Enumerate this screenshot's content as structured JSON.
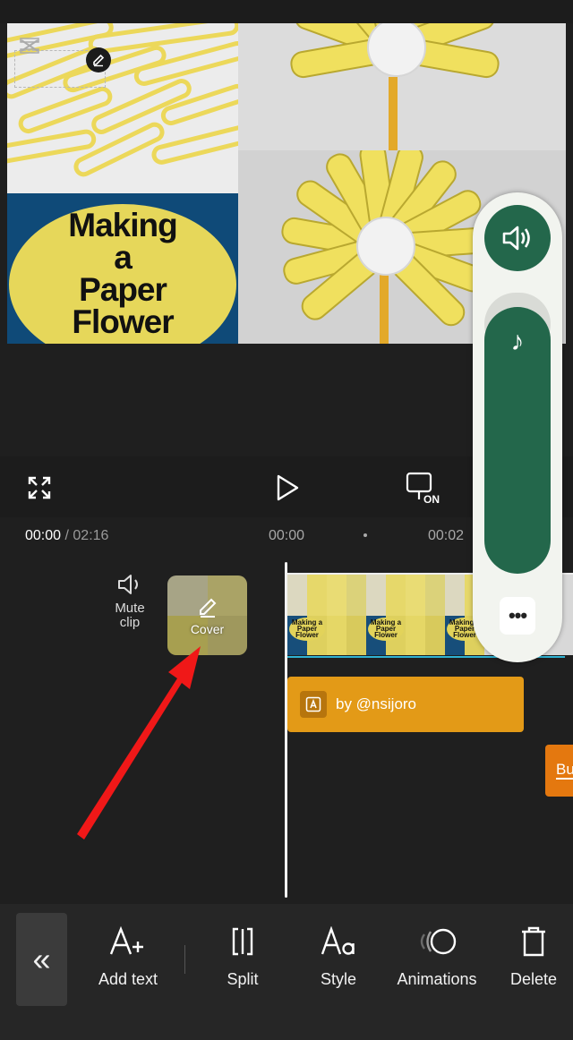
{
  "preview": {
    "title_lines": [
      "Making",
      "a",
      "Paper",
      "Flower"
    ]
  },
  "playback": {
    "current_time": "00:00",
    "separator": " / ",
    "total_time": "02:16",
    "ruler_labels": [
      "00:00",
      "00:02"
    ]
  },
  "timeline": {
    "mute_label_line1": "Mute",
    "mute_label_line2": "clip",
    "cover_label": "Cover",
    "text_track_label": "by @nsijoro",
    "next_track_label": "Bu",
    "thumb_title": "Making a Paper Flower"
  },
  "volume_panel": {
    "more_label": "•••"
  },
  "toolbar": {
    "collapse_label": "«",
    "items": [
      {
        "label": "Add text",
        "icon": "add-text-icon"
      },
      {
        "label": "Split",
        "icon": "split-icon"
      },
      {
        "label": "Style",
        "icon": "style-icon"
      },
      {
        "label": "Animations",
        "icon": "animations-icon"
      },
      {
        "label": "Delete",
        "icon": "trash-icon"
      }
    ]
  },
  "colors": {
    "accent_green": "#23674b",
    "text_track": "#e39a17",
    "annotation_arrow": "#f01818"
  }
}
